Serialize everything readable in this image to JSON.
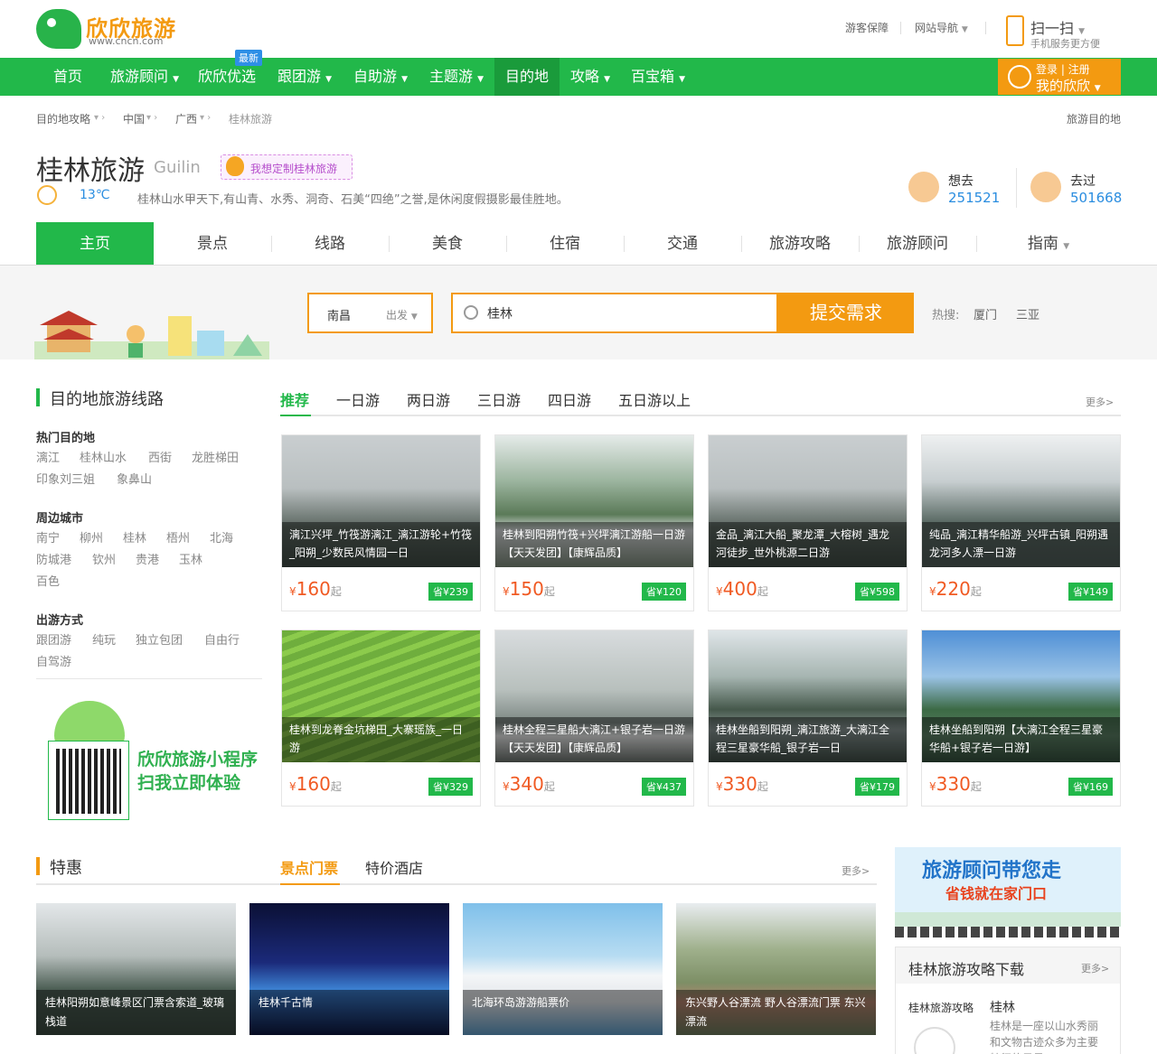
{
  "site": {
    "logo": "欣欣旅游",
    "logo_sub": "www.cncn.com",
    "top_links": [
      "游客保障",
      "网站导航"
    ],
    "scan_title": "扫一扫",
    "scan_sub": "手机服务更方便"
  },
  "nav": {
    "items": [
      "首页",
      "旅游顾问",
      "欣欣优选",
      "跟团游",
      "自助游",
      "主题游",
      "目的地",
      "攻略",
      "百宝箱"
    ],
    "new_tag": "最新",
    "login": "登录 | 注册",
    "my": "我的欣欣"
  },
  "breadcrumb": [
    "目的地攻略",
    "中国",
    "广西",
    "桂林旅游"
  ],
  "breadcrumb_right": "旅游目的地",
  "city": {
    "name": "桂林旅游",
    "en": "Guilin",
    "custom": "我想定制桂林旅游",
    "temp": "13℃",
    "desc": "桂林山水甲天下,有山青、水秀、洞奇、石美“四绝”之誉,是休闲度假摄影最佳胜地。",
    "want_label": "想去",
    "want": "251521",
    "been_label": "去过",
    "been": "501668"
  },
  "tabs": [
    "主页",
    "景点",
    "线路",
    "美食",
    "住宿",
    "交通",
    "旅游攻略",
    "旅游顾问",
    "指南"
  ],
  "search": {
    "from": "南昌",
    "from_label": "出发",
    "value": "桂林",
    "button": "提交需求",
    "hot_label": "热搜:",
    "hot": [
      "厦门",
      "三亚"
    ]
  },
  "routes": {
    "title": "目的地旅游线路",
    "tabs": [
      "推荐",
      "一日游",
      "两日游",
      "三日游",
      "四日游",
      "五日游以上"
    ],
    "more": "更多>",
    "groups": [
      {
        "title": "热门目的地",
        "links": [
          "漓江",
          "桂林山水",
          "西街",
          "龙胜梯田",
          "印象刘三姐",
          "象鼻山"
        ]
      },
      {
        "title": "周边城市",
        "links": [
          "南宁",
          "柳州",
          "桂林",
          "梧州",
          "北海",
          "防城港",
          "钦州",
          "贵港",
          "玉林",
          "百色"
        ]
      },
      {
        "title": "出游方式",
        "links": [
          "跟团游",
          "纯玩",
          "独立包团",
          "自由行",
          "自驾游"
        ]
      }
    ],
    "mini1": "欣欣旅游小程序",
    "mini2": "扫我立即体验",
    "cards": [
      {
        "title": "漓江兴坪_竹筏游漓江_漓江游轮+竹筏_阳朔_少数民风情园一日",
        "price": "160",
        "save": "省¥239"
      },
      {
        "title": "桂林到阳朔竹筏+兴坪漓江游船一日游【天天发团】【康辉品质】",
        "price": "150",
        "save": "省¥120"
      },
      {
        "title": "金品_漓江大船_聚龙潭_大榕树_遇龙河徒步_世外桃源二日游",
        "price": "400",
        "save": "省¥598"
      },
      {
        "title": "纯品_漓江精华船游_兴坪古镇_阳朔遇龙河多人漂一日游",
        "price": "220",
        "save": "省¥149"
      },
      {
        "title": "桂林到龙脊金坑梯田_大寨瑶族_一日游",
        "price": "160",
        "save": "省¥329"
      },
      {
        "title": "桂林全程三星船大漓江+银子岩一日游【天天发团】【康辉品质】",
        "price": "340",
        "save": "省¥437"
      },
      {
        "title": "桂林坐船到阳朔_漓江旅游_大漓江全程三星豪华船_银子岩一日",
        "price": "330",
        "save": "省¥179"
      },
      {
        "title": "桂林坐船到阳朔【大漓江全程三星豪华船+银子岩一日游】",
        "price": "330",
        "save": "省¥169"
      }
    ]
  },
  "deals": {
    "title": "特惠",
    "tabs": [
      "景点门票",
      "特价酒店"
    ],
    "more": "更多>",
    "cards": [
      "桂林阳朔如意峰景区门票含索道_玻璃栈道",
      "桂林千古情",
      "北海环岛游游船票价",
      "东兴野人谷漂流 野人谷漂流门票 东兴漂流"
    ]
  },
  "price_unit": "起",
  "currency": "¥",
  "side": {
    "banner1": "旅游顾问带您走",
    "banner2": "省钱就在家门口",
    "guide_title": "桂林旅游攻略下载",
    "more": "更多>",
    "book": "桂林旅游攻略",
    "book_name": "桂林",
    "book_desc": "桂林是一座以山水秀丽和文物古迹众多为主要特征的风景"
  }
}
